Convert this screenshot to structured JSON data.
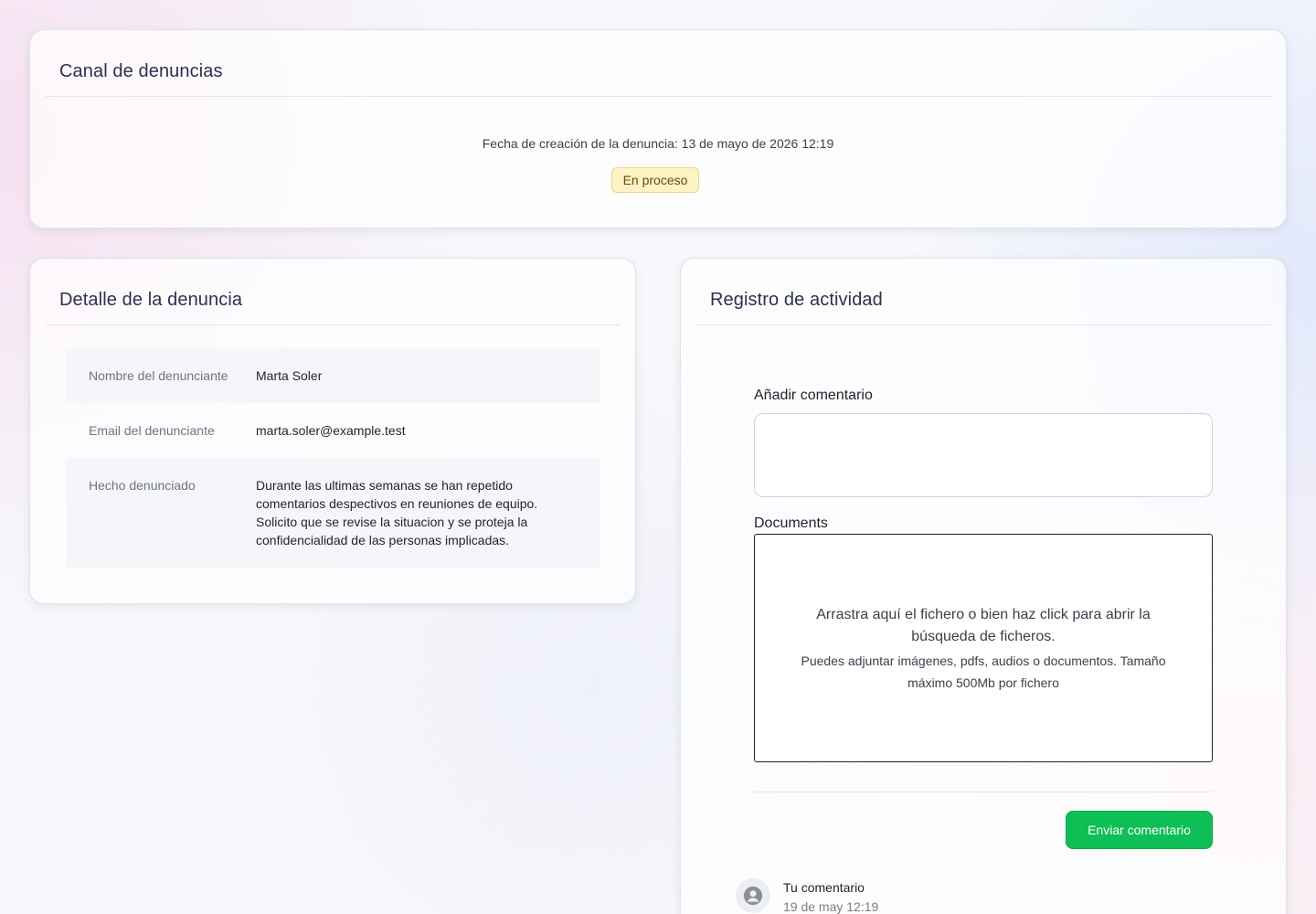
{
  "canal": {
    "title": "Canal de denuncias",
    "created_label": "Fecha de creación de la denuncia: 13 de mayo de 2026 12:19",
    "status": "En proceso"
  },
  "detalle": {
    "title": "Detalle de la denuncia",
    "rows": [
      {
        "label": "Nombre del denunciante",
        "value": "Marta Soler"
      },
      {
        "label": "Email del denunciante",
        "value": "marta.soler@example.test"
      },
      {
        "label": "Hecho denunciado",
        "value": "Durante las ultimas semanas se han repetido comentarios despectivos en reuniones de equipo. Solicito que se revise la situacion y se proteja la confidencialidad de las personas implicadas."
      }
    ]
  },
  "registro": {
    "title": "Registro de actividad",
    "comment_label": "Añadir comentario",
    "comment_value": "",
    "documents_label": "Documents",
    "dropzone_main": "Arrastra aquí el fichero o bien haz click para abrir la búsqueda de ficheros.",
    "dropzone_sub": "Puedes adjuntar imágenes, pdfs, audios o documentos. Tamaño máximo 500Mb por fichero",
    "send_label": "Enviar comentario",
    "activity": [
      {
        "title": "Tu comentario",
        "time": "19 de may 12:19",
        "icon": "user-avatar-icon"
      }
    ]
  },
  "colors": {
    "accent_green": "#0ebf55",
    "status_bg": "#fdf3c4",
    "status_text": "#6b4b0a"
  }
}
